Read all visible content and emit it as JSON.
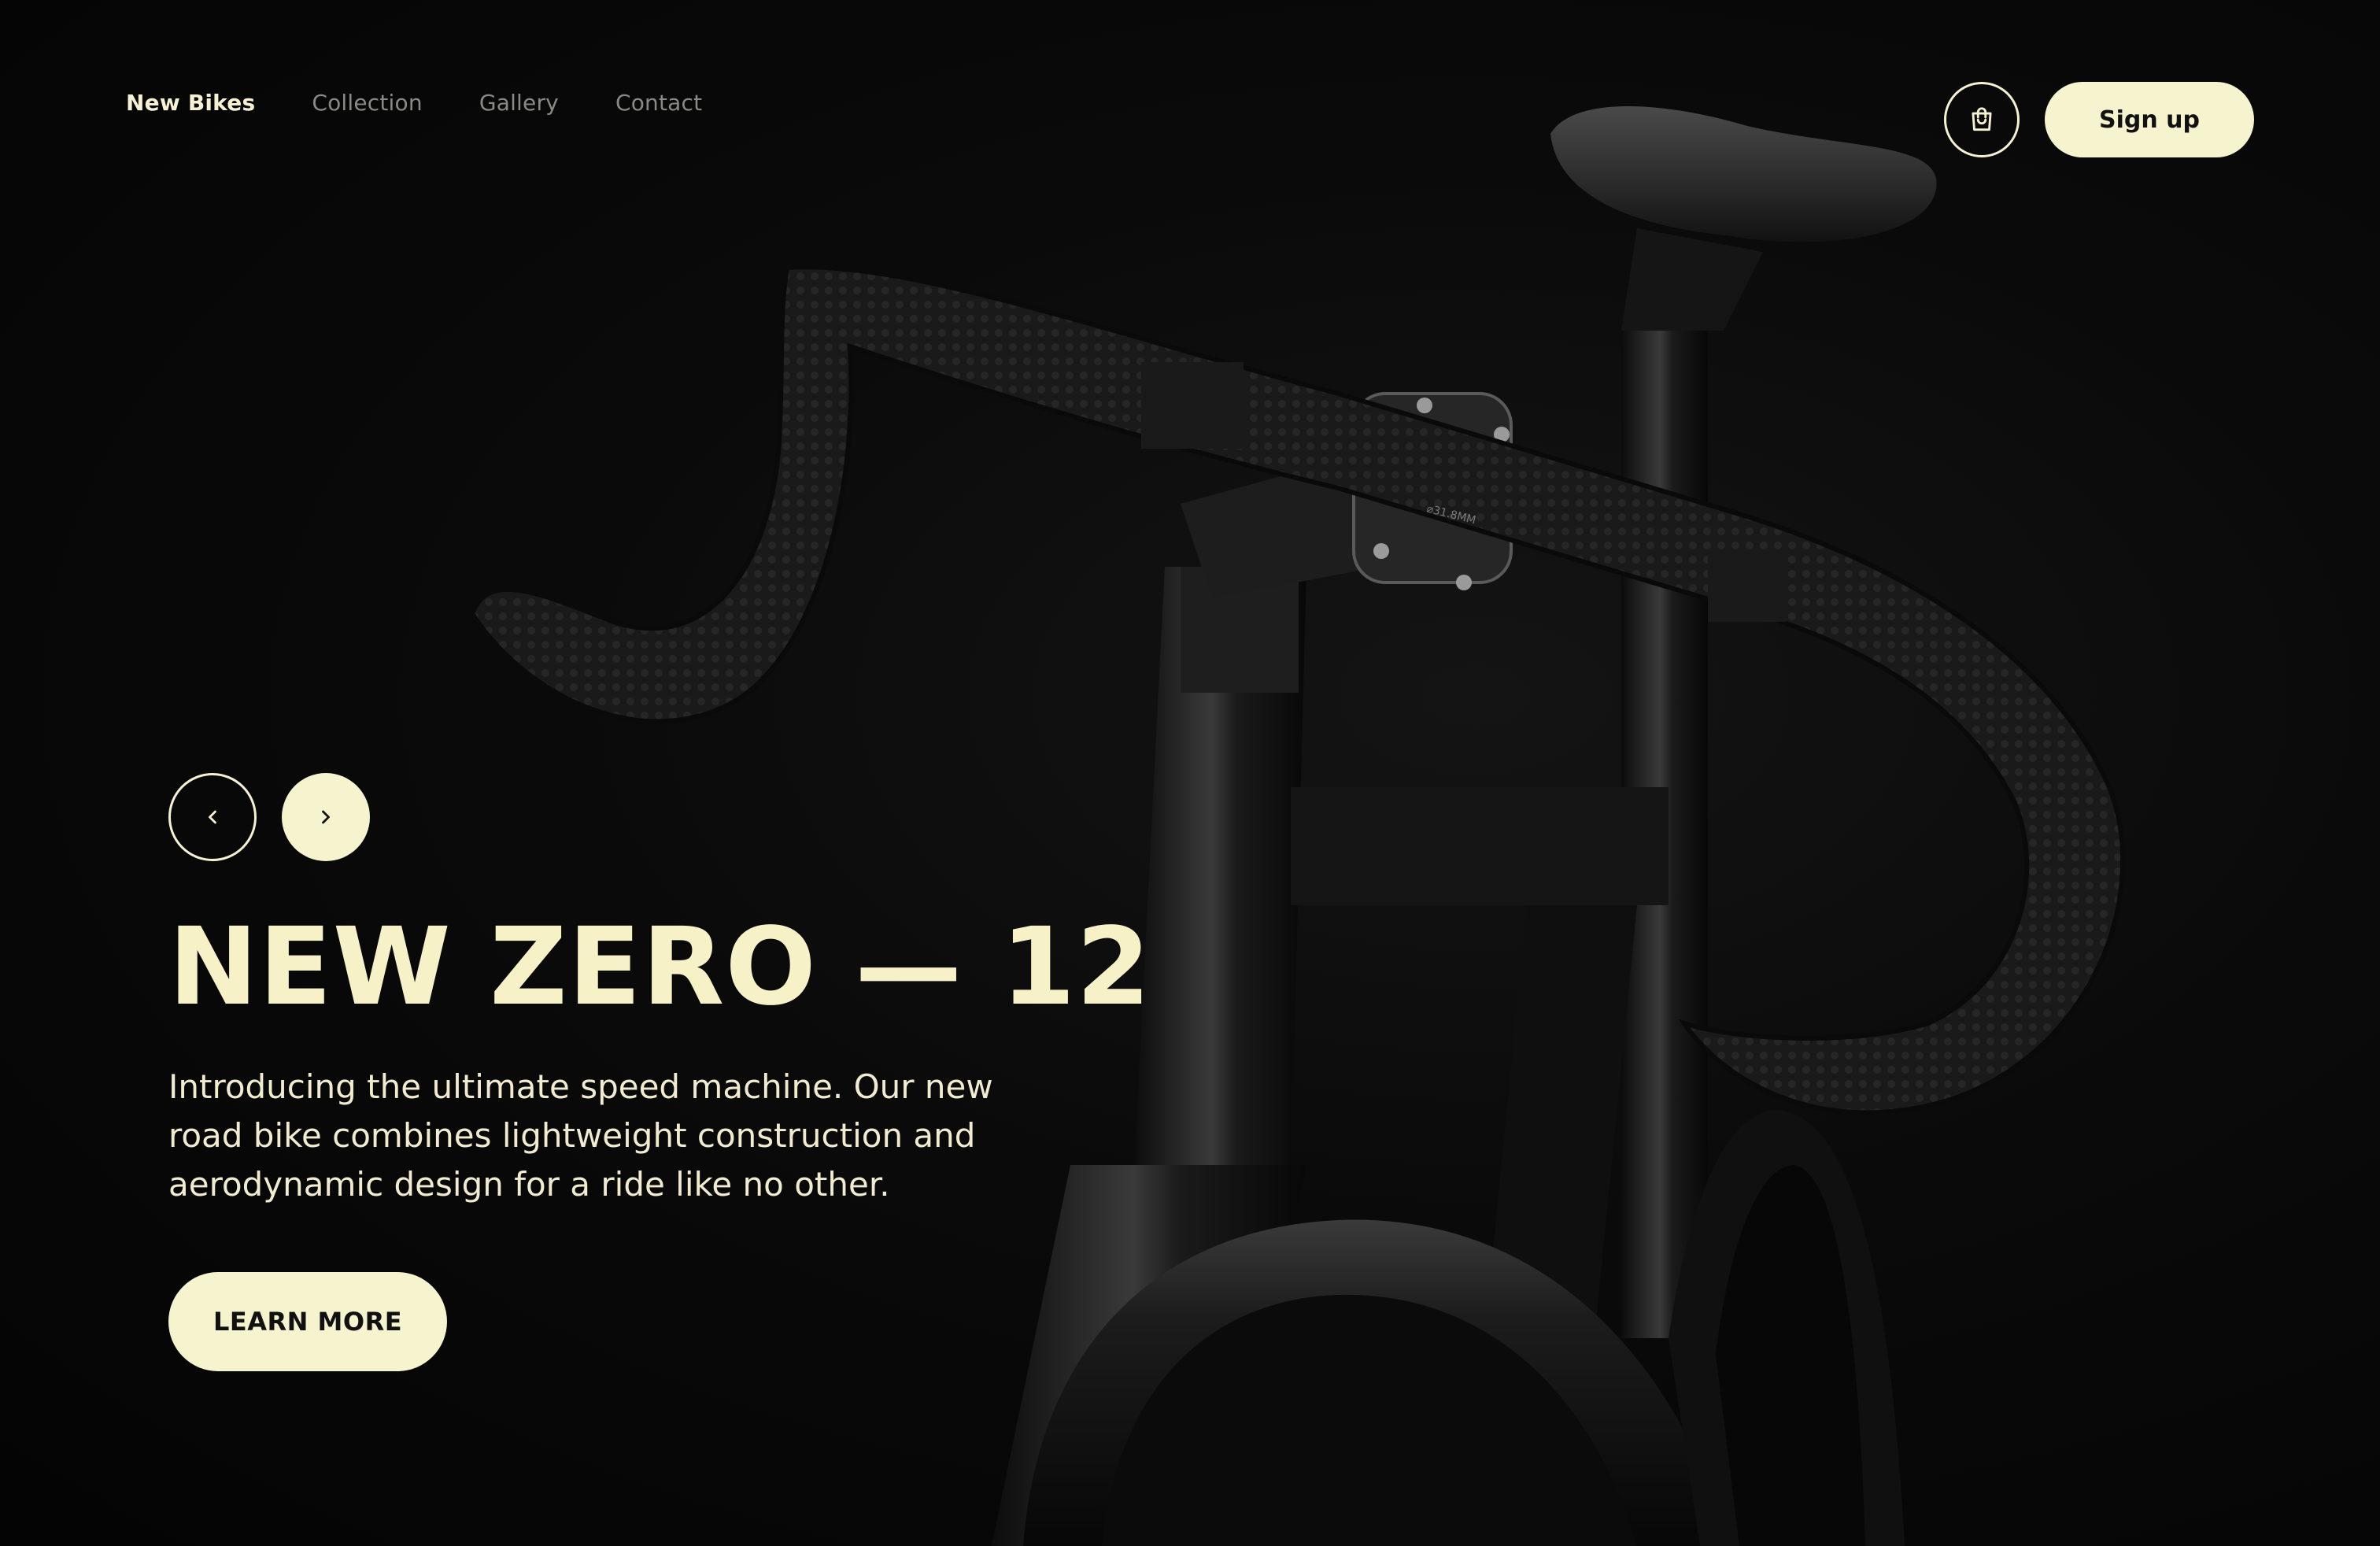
{
  "nav": {
    "items": [
      {
        "label": "New Bikes",
        "active": true
      },
      {
        "label": "Collection",
        "active": false
      },
      {
        "label": "Gallery",
        "active": false
      },
      {
        "label": "Contact",
        "active": false
      }
    ]
  },
  "header": {
    "cart_icon": "shopping-bag-icon",
    "signup_label": "Sign up"
  },
  "slider": {
    "prev_icon": "chevron-left-icon",
    "next_icon": "chevron-right-icon"
  },
  "hero": {
    "title": "NEW ZERO — 12",
    "description": "Introducing the ultimate speed machine. Our new road bike combines lightweight construction and aerodynamic design for a ride like no other.",
    "cta_label": "LEARN MORE",
    "image": "black-road-bike-photo",
    "stem_marking": "⌀31.8MM"
  },
  "colors": {
    "background": "#050505",
    "accent": "#f6f3cf",
    "text_primary": "#f6f1d3",
    "text_muted": "#8a8a84"
  }
}
